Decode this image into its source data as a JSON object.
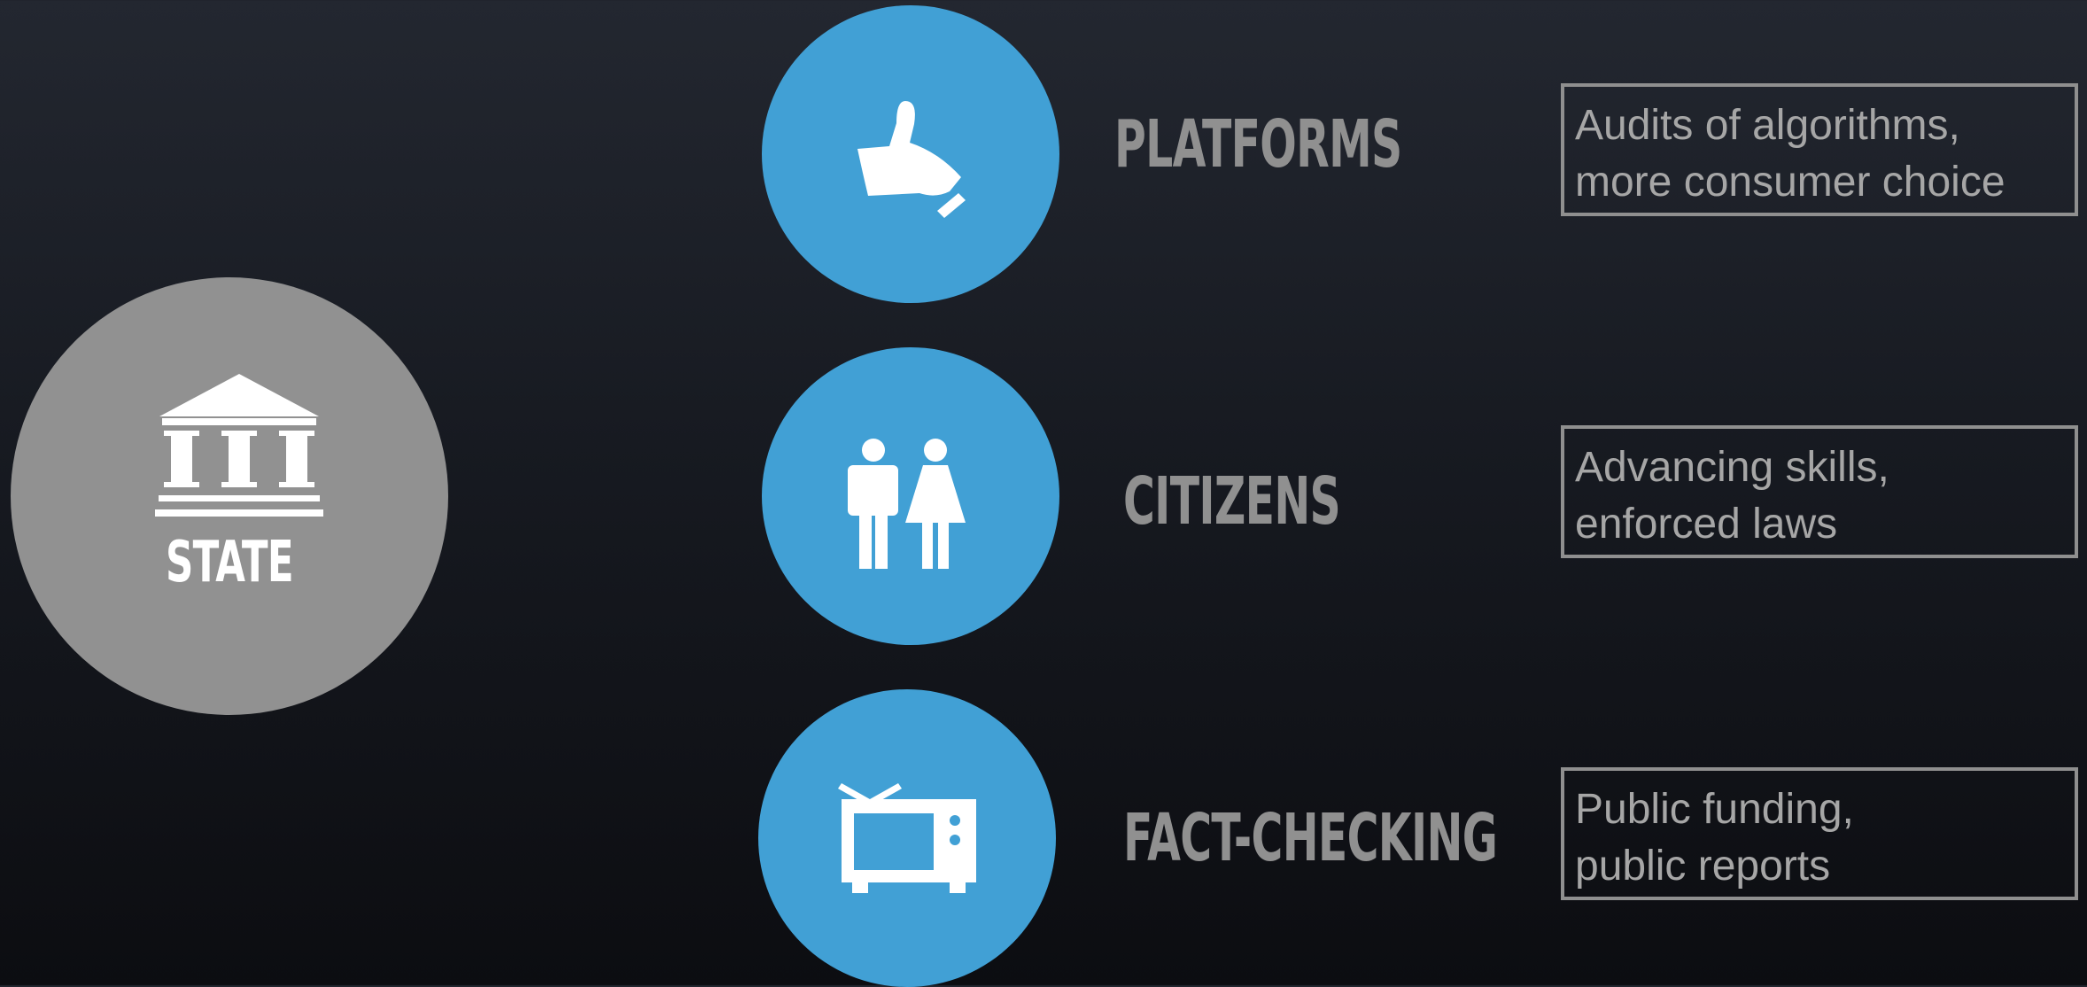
{
  "state": {
    "label": "STATE",
    "icon": "government-building-icon",
    "color": "#919191"
  },
  "accent_color": "#41a0d5",
  "items": [
    {
      "label": "PLATFORMS",
      "icon": "thumbs-up-icon",
      "description": [
        "Audits of algorithms,",
        "more consumer choice"
      ]
    },
    {
      "label": "CITIZENS",
      "icon": "man-woman-icon",
      "description": [
        "Advancing skills,",
        "enforced laws"
      ]
    },
    {
      "label": "FACT-CHECKING",
      "icon": "television-icon",
      "description": [
        "Public funding,",
        "public reports"
      ]
    }
  ]
}
